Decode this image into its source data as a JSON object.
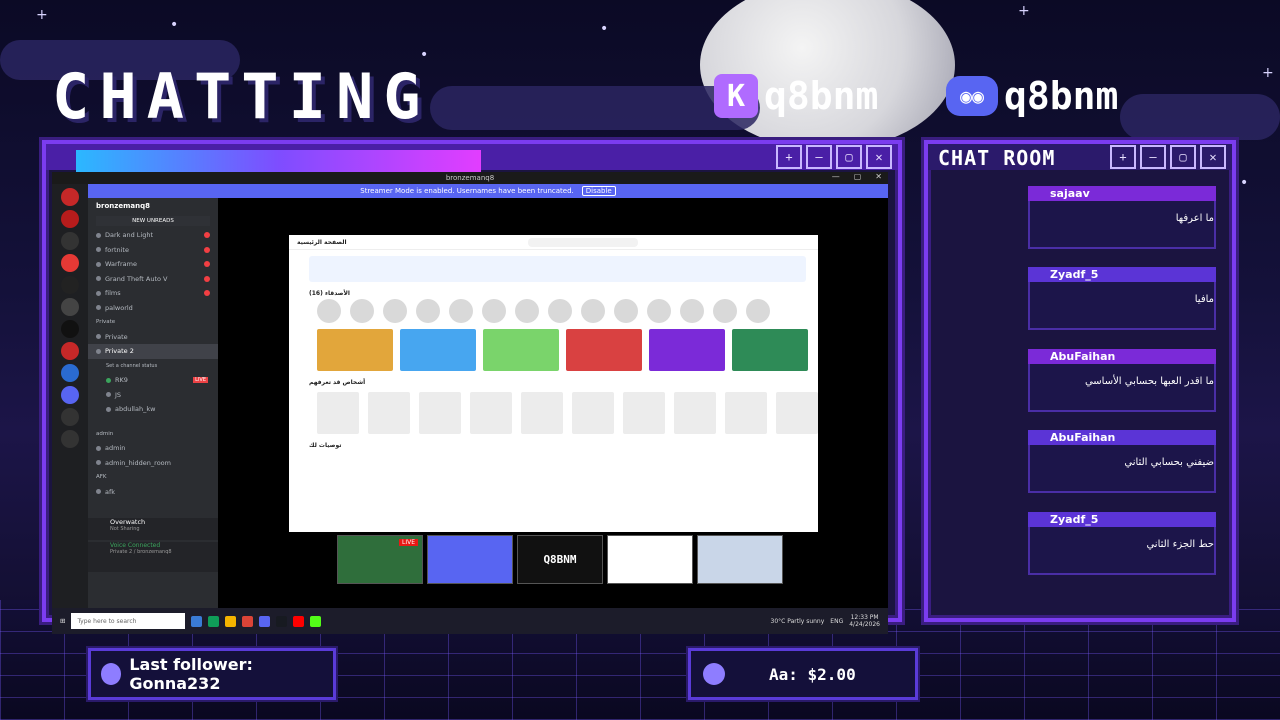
{
  "overlay": {
    "title": "CHATTING",
    "kick_handle": "q8bnm",
    "discord_handle": "q8bnm",
    "kick_icon_glyph": "K",
    "chat_room_title": "CHAT ROOM",
    "stream_progress": 0.75,
    "window_button_glyphs": [
      "+",
      "—",
      "▢",
      "✕"
    ]
  },
  "chat": {
    "messages": [
      {
        "user": "sajaav",
        "text": "ما اعرفها",
        "header_color": "#7b2ad8"
      },
      {
        "user": "Zyadf_5",
        "text": "مافيا",
        "header_color": "#5b34d6"
      },
      {
        "user": "AbuFaihan",
        "text": "ما اقدر العبها بحسابي الأساسي",
        "header_color": "#7b2ad8"
      },
      {
        "user": "AbuFaihan",
        "text": "ضيفني بحسابي الثاني",
        "header_color": "#5b34d6"
      },
      {
        "user": "Zyadf_5",
        "text": "حط الجزء الثاني",
        "header_color": "#5b34d6"
      }
    ]
  },
  "screen": {
    "window_title": "bronzemanq8",
    "streamer_banner": "Streamer Mode is enabled. Usernames have been truncated.",
    "disable_label": "Disable",
    "window_controls": [
      "—",
      "▢",
      "✕"
    ],
    "discord": {
      "server_name": "bronzemanq8",
      "new_unreads": "NEW UNREADS",
      "channels": [
        "Dark and Light",
        "fortnite",
        "Warframe",
        "Grand Theft Auto V",
        "films",
        "palworld"
      ],
      "private_category": "Private",
      "private_channels": [
        "Private",
        "Private 2"
      ],
      "channel_status_hint": "Set a channel status",
      "live_badge": "LIVE",
      "voice_members": [
        "RK9",
        "JS",
        "abdullah_kw"
      ],
      "admin_category": "admin",
      "admin_channels": [
        "admin",
        "admin_hidden_room"
      ],
      "afk_category": "AFK",
      "afk_channel": "afk",
      "activity_title": "Overwatch",
      "activity_sub": "Not Sharing",
      "voice_status": "Voice Connected",
      "voice_channel": "Private 2 / bronzemanq8"
    },
    "roblox": {
      "home_title": "الصفحة الرئيسية",
      "search_placeholder": "البحث",
      "friends_header": "الأصدقاء (16)",
      "people_header": "أشخاص قد تعرفهم",
      "recommended_header": "توصيات لك",
      "tile_colors": [
        "#e2a63b",
        "#47a6f0",
        "#7ad46b",
        "#d94141",
        "#7b2ad8",
        "#2e8b57"
      ]
    },
    "taskbar": {
      "search_placeholder": "Type here to search",
      "weather": "30°C  Partly sunny",
      "lang": "ENG",
      "time": "12:33 PM",
      "date": "4/24/2026"
    },
    "thumbnails": [
      {
        "name": "stream-preview",
        "live": "LIVE",
        "color": "#2f6e3b"
      },
      {
        "name": "discord",
        "color": "#5865f2"
      },
      {
        "name": "q8bnm-logo",
        "text": "Q8BNM",
        "color": "#111111"
      },
      {
        "name": "kuwait-flag",
        "color": "#ffffff"
      },
      {
        "name": "avatar",
        "color": "#c9d6e8"
      }
    ]
  },
  "widgets": {
    "last_follower": "Last follower: Gonna232",
    "donation": "Aa: $2.00"
  }
}
